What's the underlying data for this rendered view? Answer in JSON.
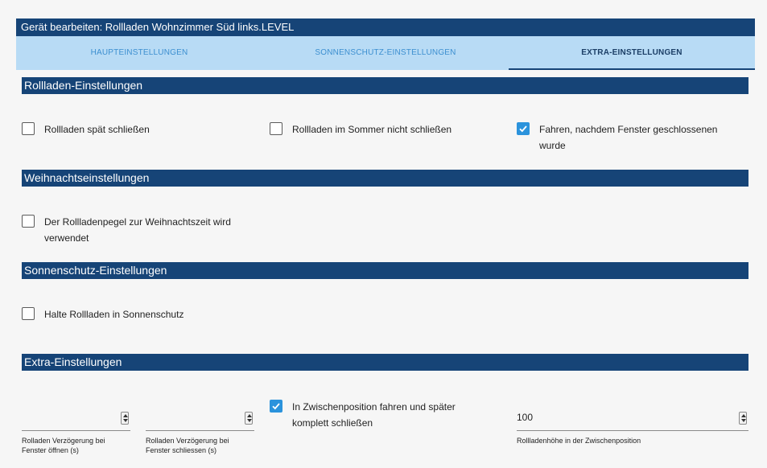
{
  "window": {
    "title": "Gerät bearbeiten: Rollladen Wohnzimmer Süd links.LEVEL"
  },
  "tabs": [
    {
      "label": "HAUPTEINSTELLUNGEN",
      "active": false
    },
    {
      "label": "SONNENSCHUTZ-EINSTELLUNGEN",
      "active": false
    },
    {
      "label": "EXTRA-EINSTELLUNGEN",
      "active": true
    }
  ],
  "sections": {
    "rollladen": {
      "title": "Rollladen-Einstellungen",
      "items": [
        {
          "label": "Rollladen spät schließen",
          "checked": false
        },
        {
          "label": "Rollladen im Sommer nicht schließen",
          "checked": false
        },
        {
          "label_line1": "Fahren, nachdem Fenster geschlossenen",
          "label_line2": "wurde",
          "checked": true
        }
      ]
    },
    "weihnachten": {
      "title": "Weihnachtseinstellungen",
      "items": [
        {
          "label_line1": "Der Rollladenpegel zur Weihnachtszeit wird",
          "label_line2": "verwendet",
          "checked": false
        }
      ]
    },
    "sonnenschutz": {
      "title": "Sonnenschutz-Einstellungen",
      "items": [
        {
          "label": "Halte Rollladen in Sonnenschutz",
          "checked": false
        }
      ]
    },
    "extra": {
      "title": "Extra-Einstellungen",
      "fields": [
        {
          "value": "",
          "label_line1": "Rolladen Verzögerung bei",
          "label_line2": "Fenster öffnen (s)"
        },
        {
          "value": "",
          "label_line1": "Rolladen Verzögerung bei",
          "label_line2": "Fenster schliessen (s)"
        },
        {
          "value": "100",
          "label_line1": "Rollladenhöhe in der Zwischenposition",
          "label_line2": ""
        }
      ],
      "checkbox": {
        "label_line1": "In Zwischenposition fahren und später",
        "label_line2": "komplett schließen",
        "checked": true
      }
    }
  },
  "colors": {
    "header": "#164477",
    "tabs_bg": "#b8dbf5",
    "tab_text": "#3c8fd0",
    "checkbox_checked": "#2b93dc"
  }
}
